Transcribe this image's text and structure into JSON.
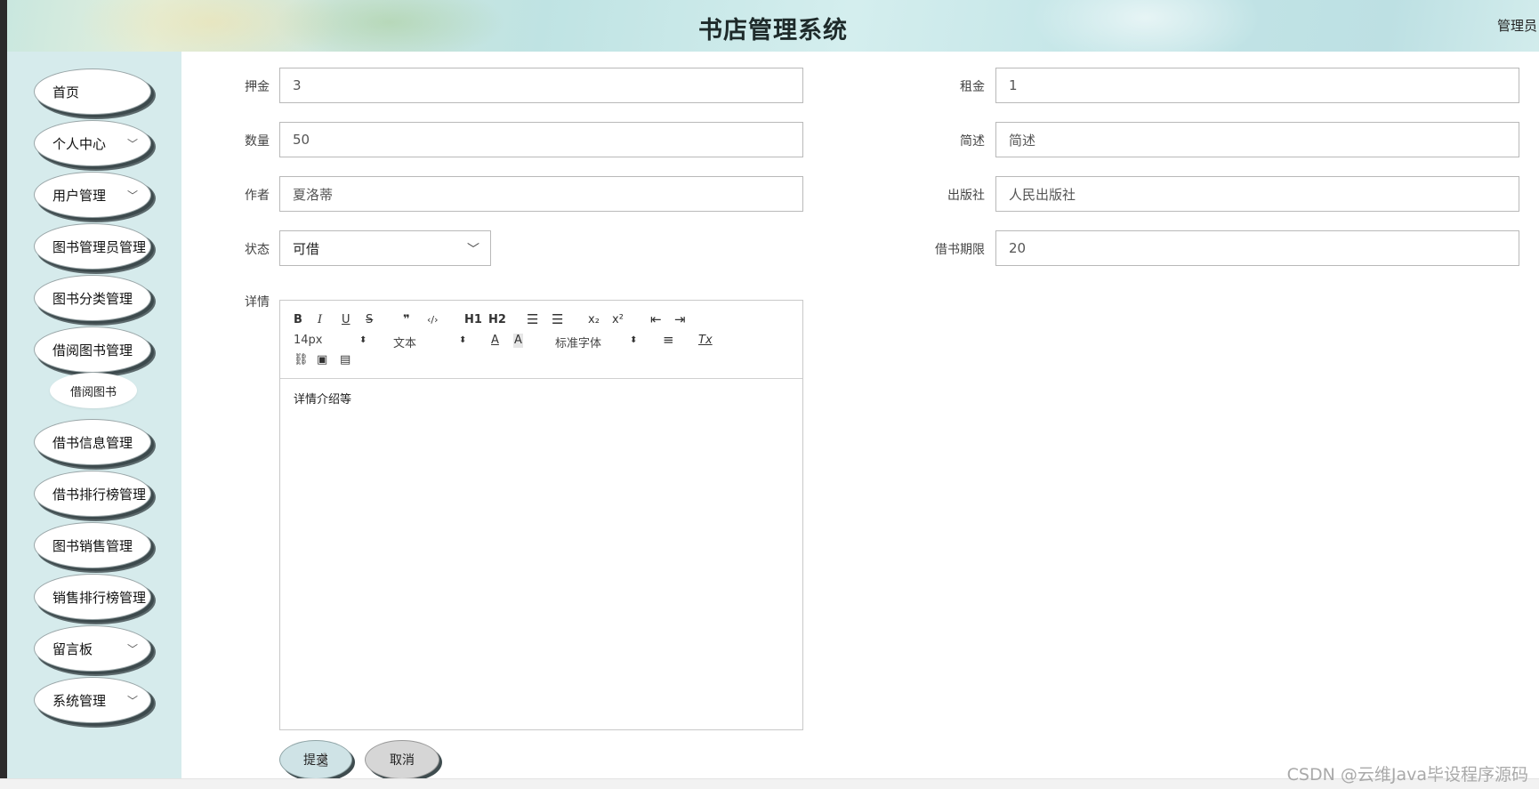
{
  "app": {
    "title": "书店管理系统",
    "user_label": "管理员"
  },
  "sidebar": {
    "items": [
      {
        "label": "首页",
        "has_chevron": false
      },
      {
        "label": "个人中心",
        "has_chevron": true
      },
      {
        "label": "用户管理",
        "has_chevron": true
      },
      {
        "label": "图书管理员管理",
        "has_chevron": false
      },
      {
        "label": "图书分类管理",
        "has_chevron": false
      },
      {
        "label": "借阅图书管理",
        "has_chevron": false
      },
      {
        "label": "借书信息管理",
        "has_chevron": false
      },
      {
        "label": "借书排行榜管理",
        "has_chevron": false
      },
      {
        "label": "图书销售管理",
        "has_chevron": false
      },
      {
        "label": "销售排行榜管理",
        "has_chevron": false
      },
      {
        "label": "留言板",
        "has_chevron": true
      },
      {
        "label": "系统管理",
        "has_chevron": true
      }
    ],
    "sub_item": {
      "label": "借阅图书"
    }
  },
  "form": {
    "deposit": {
      "label": "押金",
      "value": "3"
    },
    "rent": {
      "label": "租金",
      "value": "1"
    },
    "quantity": {
      "label": "数量",
      "value": "50"
    },
    "summary": {
      "label": "简述",
      "value": "简述"
    },
    "author": {
      "label": "作者",
      "value": "夏洛蒂"
    },
    "publisher": {
      "label": "出版社",
      "value": "人民出版社"
    },
    "status": {
      "label": "状态",
      "value": "可借"
    },
    "loan_period": {
      "label": "借书期限",
      "value": "20"
    },
    "details": {
      "label": "详情",
      "content": "详情介绍等"
    }
  },
  "editor_toolbar": {
    "bold": "B",
    "italic": "I",
    "underline": "U",
    "strike": "S",
    "quote": "❞",
    "code": "‹/›",
    "h1": "H1",
    "h2": "H2",
    "ordered_list": "☰",
    "bullet_list": "☰",
    "subscript": "x₂",
    "superscript": "x²",
    "outdent": "⇤",
    "indent": "⇥",
    "font_size": "14px",
    "text_type": "文本",
    "font_color": "A",
    "bg_color": "A",
    "font_family": "标准字体",
    "align": "≡",
    "clear_format": "Tx",
    "link": "⛓",
    "image": "▣",
    "video": "▤"
  },
  "buttons": {
    "submit": "提交",
    "cancel": "取消"
  },
  "watermark": "CSDN @云维Java毕设程序源码",
  "colors": {
    "sidebar_bg": "#d6ebec",
    "submit_bg": "#cfe3e6",
    "cancel_bg": "#d6d6d6"
  }
}
